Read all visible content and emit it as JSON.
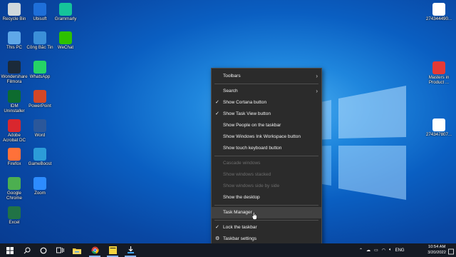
{
  "desktop": {
    "icons_left": [
      {
        "label": "Recycle Bin",
        "icon": "recycle-bin-icon",
        "color": "#cfd8dc"
      },
      {
        "label": "Ubisoft",
        "icon": "ubisoft-icon",
        "color": "#1e6fd9"
      },
      {
        "label": "Grammarly",
        "icon": "grammarly-icon",
        "color": "#15c39a"
      },
      {
        "label": "This PC",
        "icon": "computer-icon",
        "color": "#5fa8e8"
      },
      {
        "label": "Công Bắc Tin",
        "icon": "shortcut-icon",
        "color": "#3b8fd8"
      },
      {
        "label": "WeChat",
        "icon": "wechat-icon",
        "color": "#2dc100"
      },
      {
        "label": "Wondershare Filmora",
        "icon": "filmora-icon",
        "color": "#1b2a3a"
      },
      {
        "label": "WhatsApp",
        "icon": "whatsapp-icon",
        "color": "#25d366"
      },
      {
        "label": "IDM Uninstaller",
        "icon": "idm-icon",
        "color": "#0d6b2f"
      },
      {
        "label": "PowerPoint",
        "icon": "powerpoint-icon",
        "color": "#d24726"
      },
      {
        "label": "Adobe Acrobat DC",
        "icon": "acrobat-icon",
        "color": "#d9272e"
      },
      {
        "label": "Word",
        "icon": "word-icon",
        "color": "#2b579a"
      },
      {
        "label": "Firefox",
        "icon": "firefox-icon",
        "color": "#ff7139"
      },
      {
        "label": "GameBoost",
        "icon": "gameboost-icon",
        "color": "#2c9cd8"
      },
      {
        "label": "Google Chrome",
        "icon": "chrome-icon",
        "color": "#4caf50"
      },
      {
        "label": "Zoom",
        "icon": "zoom-icon",
        "color": "#2d8cff"
      },
      {
        "label": "Excel",
        "icon": "excel-icon",
        "color": "#217346"
      }
    ],
    "icons_right": [
      {
        "label": "274344490...",
        "icon": "phone-file-icon",
        "color": "#ffffff"
      },
      {
        "label": "Masters in Product ...",
        "icon": "pdf-icon",
        "color": "#e53935"
      },
      {
        "label": "274347807...",
        "icon": "phone-file-icon",
        "color": "#ffffff"
      }
    ]
  },
  "context_menu": {
    "toolbars": "Toolbars",
    "search": "Search",
    "show_cortana": "Show Cortana button",
    "show_task_view": "Show Task View button",
    "show_people": "Show People on the taskbar",
    "show_ink": "Show Windows Ink Workspace button",
    "show_keyboard": "Show touch keyboard button",
    "cascade": "Cascade windows",
    "stacked": "Show windows stacked",
    "side_by_side": "Show windows side by side",
    "show_desktop": "Show the desktop",
    "task_manager": "Task Manager",
    "lock_taskbar": "Lock the taskbar",
    "taskbar_settings": "Taskbar settings",
    "check_glyph": "✓",
    "arrow_glyph": "›"
  },
  "taskbar": {
    "tray_lang": "ENG",
    "time": "10:54 AM",
    "date": "3/20/2022",
    "accent": "#0a5fc2"
  }
}
